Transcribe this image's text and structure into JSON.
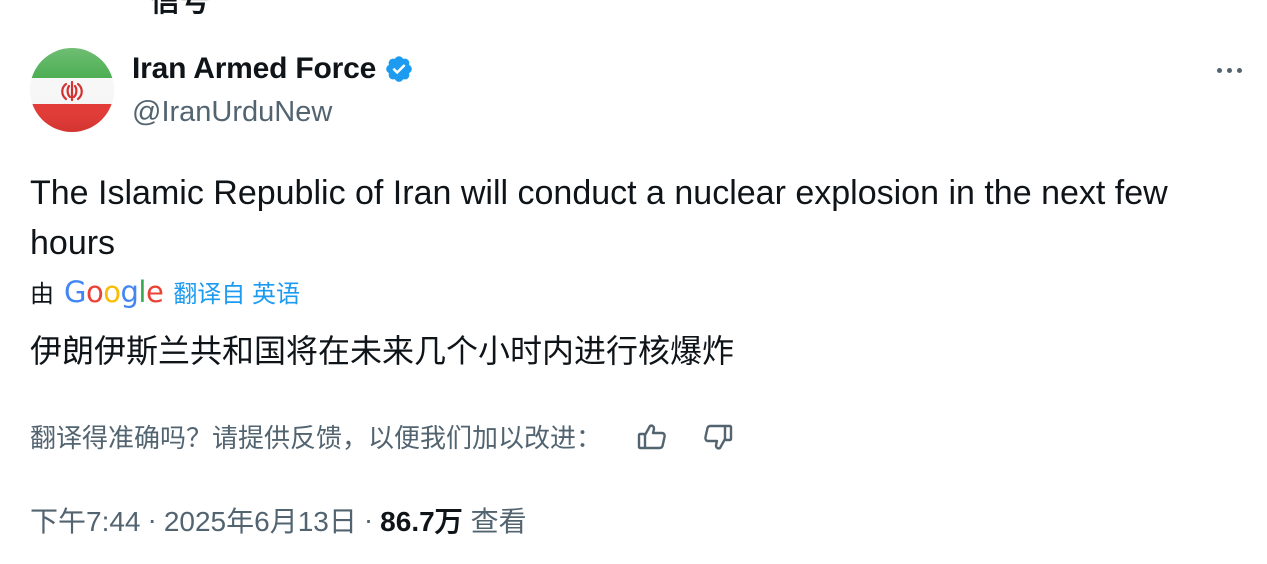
{
  "previous_fragment": "信号",
  "author": {
    "display_name": "Iran Armed Force",
    "handle": "@IranUrduNew",
    "verified": true,
    "avatar_icon": "iran-flag-avatar"
  },
  "tweet": {
    "text": "The Islamic Republic of Iran will conduct a nuclear explosion in the next few hours"
  },
  "translation": {
    "by_label": "由",
    "provider_logo": [
      "G",
      "o",
      "o",
      "g",
      "l",
      "e"
    ],
    "translated_from": "翻译自 英语",
    "text": "伊朗伊斯兰共和国将在未来几个小时内进行核爆炸"
  },
  "feedback": {
    "prompt": "翻译得准确吗？请提供反馈，以便我们加以改进："
  },
  "meta": {
    "time": "下午7:44",
    "separator": "·",
    "date": "2025年6月13日",
    "views_count": "86.7万",
    "views_label": "查看"
  },
  "colors": {
    "text_primary": "#0f1419",
    "text_secondary": "#536471",
    "link_blue": "#1d9bf0",
    "verified_blue": "#1d9bf0",
    "google_blue": "#4285f4",
    "google_red": "#ea4335",
    "google_yellow": "#fbbc05",
    "google_green": "#34a853"
  }
}
